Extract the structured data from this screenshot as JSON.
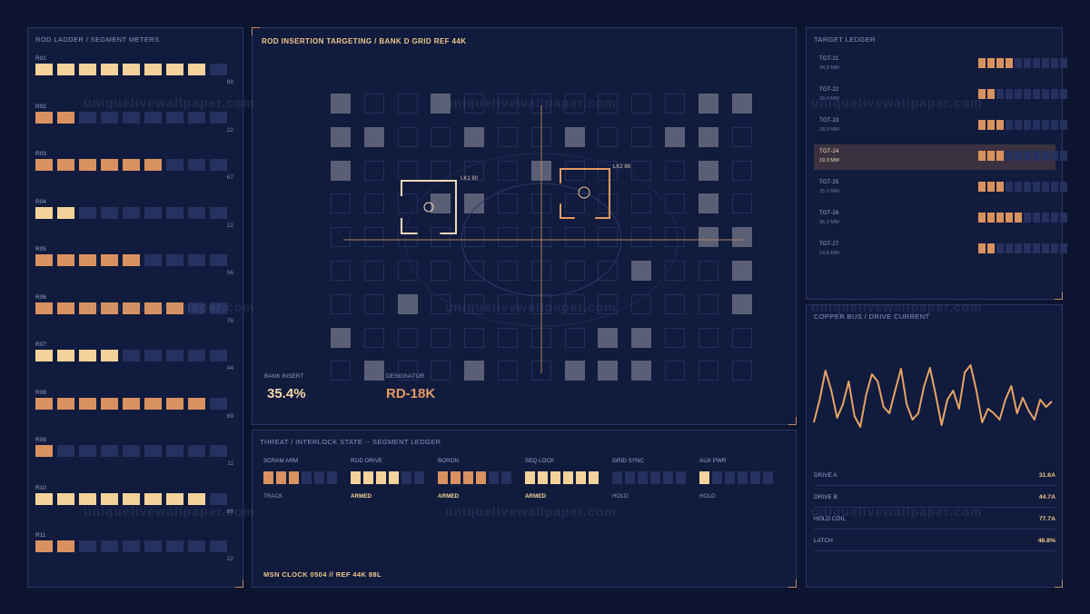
{
  "watermark": "uniquelivewallpaper.com",
  "ladder": {
    "title": "ROD LADDER / SEGMENT METERS",
    "rows": [
      {
        "label": "R01",
        "value": "89",
        "cells": [
          "l",
          "l",
          "l",
          "l",
          "l",
          "l",
          "l",
          "l",
          "d"
        ]
      },
      {
        "label": "R02",
        "value": "22",
        "cells": [
          "o",
          "o",
          "d",
          "d",
          "d",
          "d",
          "d",
          "d",
          "d"
        ]
      },
      {
        "label": "R03",
        "value": "67",
        "cells": [
          "o",
          "o",
          "o",
          "o",
          "o",
          "o",
          "d",
          "d",
          "d"
        ]
      },
      {
        "label": "R04",
        "value": "22",
        "cells": [
          "l",
          "l",
          "d",
          "d",
          "d",
          "d",
          "d",
          "d",
          "d"
        ]
      },
      {
        "label": "R05",
        "value": "56",
        "cells": [
          "o",
          "o",
          "o",
          "o",
          "o",
          "d",
          "d",
          "d",
          "d"
        ]
      },
      {
        "label": "R06",
        "value": "78",
        "cells": [
          "o",
          "o",
          "o",
          "o",
          "o",
          "o",
          "o",
          "d",
          "d"
        ]
      },
      {
        "label": "R07",
        "value": "44",
        "cells": [
          "l",
          "l",
          "l",
          "l",
          "d",
          "d",
          "d",
          "d",
          "d"
        ]
      },
      {
        "label": "R08",
        "value": "89",
        "cells": [
          "o",
          "o",
          "o",
          "o",
          "o",
          "o",
          "o",
          "o",
          "d"
        ]
      },
      {
        "label": "R09",
        "value": "11",
        "cells": [
          "o",
          "d",
          "d",
          "d",
          "d",
          "d",
          "d",
          "d",
          "d"
        ]
      },
      {
        "label": "R10",
        "value": "89",
        "cells": [
          "l",
          "l",
          "l",
          "l",
          "l",
          "l",
          "l",
          "l",
          "d"
        ]
      },
      {
        "label": "R11",
        "value": "22",
        "cells": [
          "o",
          "o",
          "d",
          "d",
          "d",
          "d",
          "d",
          "d",
          "d"
        ]
      }
    ]
  },
  "targeting": {
    "title": "ROD INSERTION TARGETING / BANK D  GRID REF 44K",
    "lock1": "LK1 80",
    "lock2": "LK2 88",
    "bank_insert_label": "BANK INSERT",
    "bank_insert_value": "35.4%",
    "designator_label": "DESIGNATOR",
    "designator_value": "RD-18K",
    "colors": {
      "insert": "#f5d8a8",
      "designator": "#e39a62"
    }
  },
  "threat": {
    "title": "THREAT / INTERLOCK STATE  --  SEGMENT LEDGER",
    "columns": [
      {
        "label": "SCRAM ARM",
        "state": "TRACK",
        "cells": [
          "o",
          "o",
          "o",
          "d",
          "d",
          "d"
        ],
        "state_color": "#8e99c5"
      },
      {
        "label": "ROD DRIVE",
        "state": "ARMED",
        "cells": [
          "l",
          "l",
          "l",
          "l",
          "d",
          "d"
        ],
        "state_color": "#f3d39b"
      },
      {
        "label": "BORON",
        "state": "ARMED",
        "cells": [
          "o",
          "o",
          "o",
          "o",
          "d",
          "d"
        ],
        "state_color": "#f3d39b"
      },
      {
        "label": "SEQ LOCK",
        "state": "ARMED",
        "cells": [
          "l",
          "l",
          "l",
          "l",
          "l",
          "l"
        ],
        "state_color": "#f3d39b"
      },
      {
        "label": "GRID SYNC",
        "state": "HOLD",
        "cells": [
          "d",
          "d",
          "d",
          "d",
          "d",
          "d"
        ],
        "state_color": "#8e99c5"
      },
      {
        "label": "AUX PWR",
        "state": "HOLD",
        "cells": [
          "l",
          "d",
          "d",
          "d",
          "d",
          "d"
        ],
        "state_color": "#8e99c5"
      }
    ],
    "footer": "MSN CLOCK 0504  //  REF 44K 88L"
  },
  "ledger": {
    "title": "TARGET LEDGER",
    "rows": [
      {
        "name": "TGT-21",
        "power": "34.8 MW",
        "cells": [
          "o",
          "o",
          "o",
          "o",
          "d",
          "d",
          "d",
          "d",
          "d",
          "d"
        ],
        "selected": false
      },
      {
        "name": "TGT-22",
        "power": "28.0 MW",
        "cells": [
          "o",
          "o",
          "d",
          "d",
          "d",
          "d",
          "d",
          "d",
          "d",
          "d"
        ],
        "selected": false
      },
      {
        "name": "TGT-23",
        "power": "28.9 MW",
        "cells": [
          "o",
          "o",
          "o",
          "d",
          "d",
          "d",
          "d",
          "d",
          "d",
          "d"
        ],
        "selected": false
      },
      {
        "name": "TGT-24",
        "power": "19.3 MW",
        "cells": [
          "o",
          "o",
          "o",
          "d",
          "d",
          "d",
          "d",
          "d",
          "d",
          "d"
        ],
        "selected": true
      },
      {
        "name": "TGT-25",
        "power": "25.9 MW",
        "cells": [
          "o",
          "o",
          "o",
          "d",
          "d",
          "d",
          "d",
          "d",
          "d",
          "d"
        ],
        "selected": false
      },
      {
        "name": "TGT-26",
        "power": "36.2 MW",
        "cells": [
          "o",
          "o",
          "o",
          "o",
          "o",
          "d",
          "d",
          "d",
          "d",
          "d"
        ],
        "selected": false
      },
      {
        "name": "TGT-27",
        "power": "24.8 MW",
        "cells": [
          "o",
          "o",
          "d",
          "d",
          "d",
          "d",
          "d",
          "d",
          "d",
          "d"
        ],
        "selected": false
      }
    ]
  },
  "copper": {
    "title": "COPPER BUS / DRIVE CURRENT",
    "readouts": [
      {
        "name": "DRIVE A",
        "value": "31.6A"
      },
      {
        "name": "DRIVE B",
        "value": "44.7A"
      },
      {
        "name": "HOLD COIL",
        "value": "77.7A"
      },
      {
        "name": "LATCH",
        "value": "46.8%"
      }
    ],
    "trace_color": "#e8a466"
  }
}
